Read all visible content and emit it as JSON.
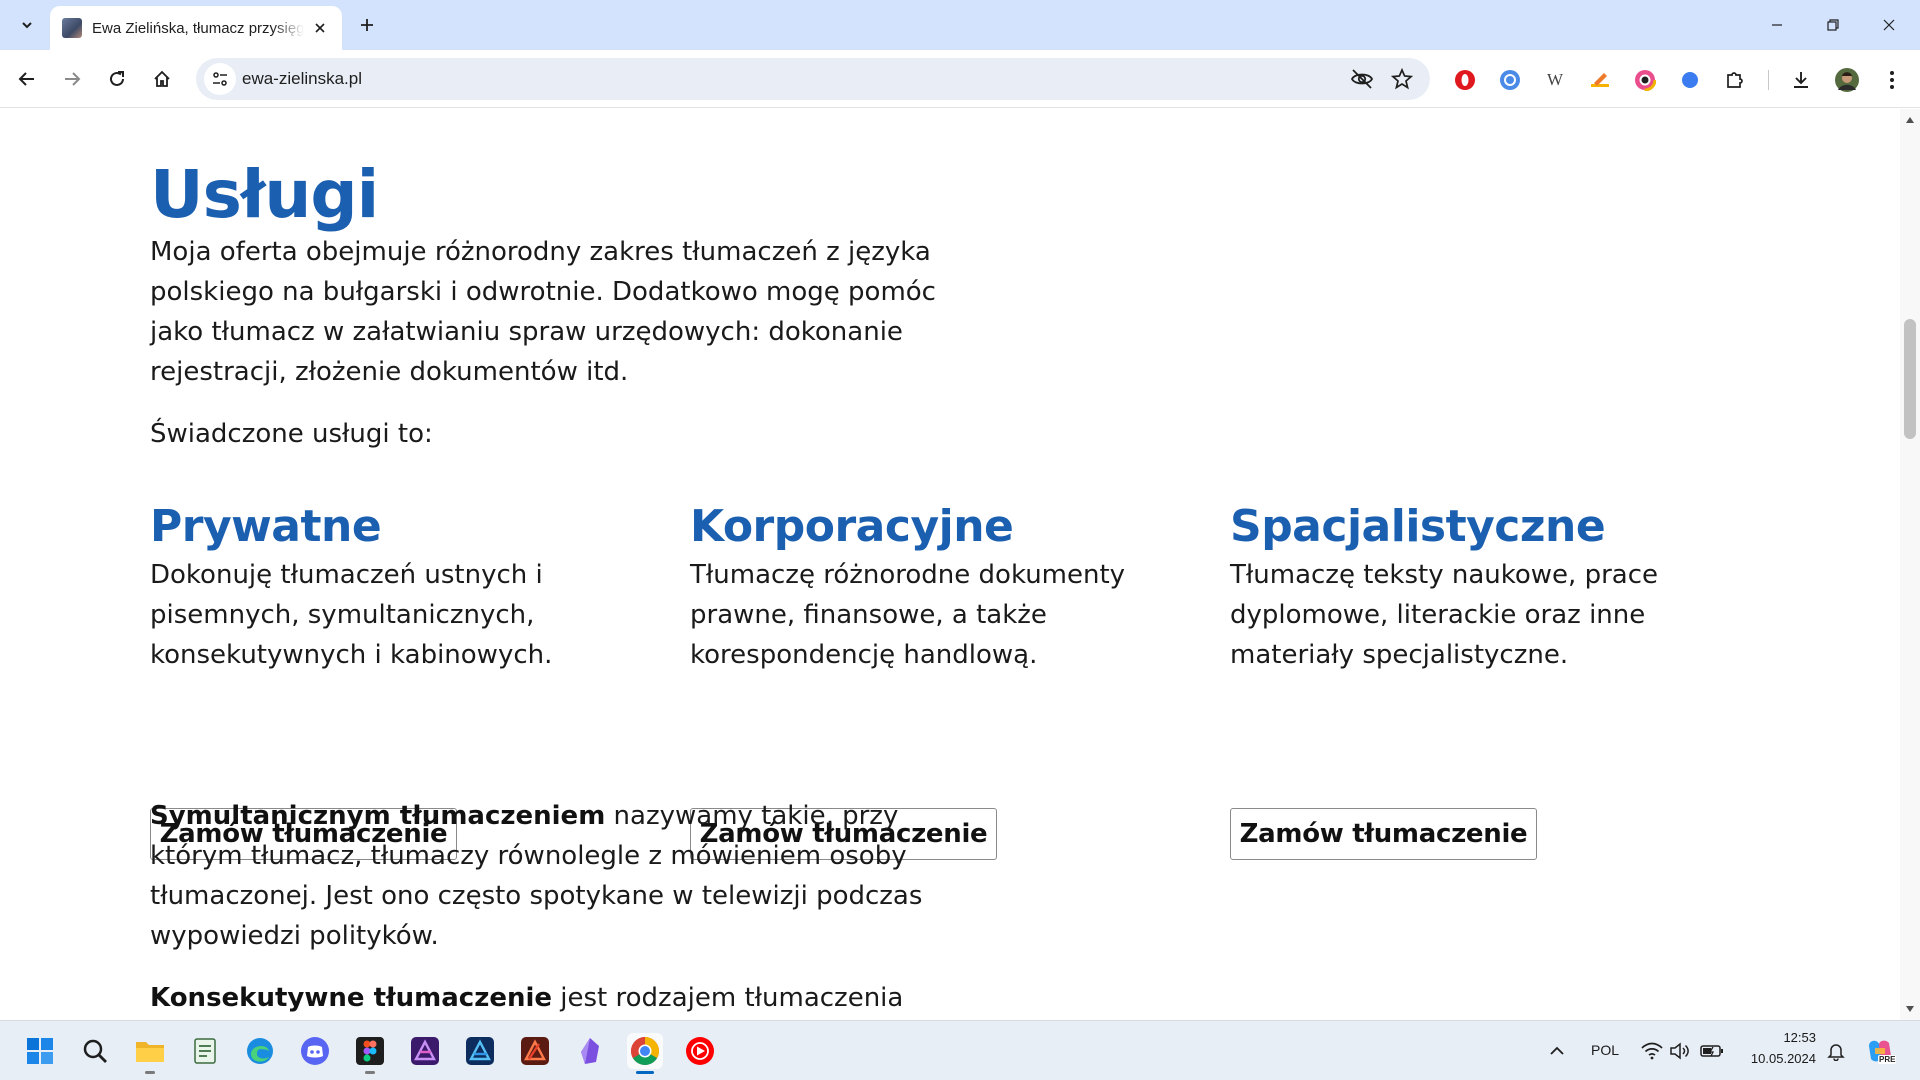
{
  "browser": {
    "tab_title": "Ewa Zielińska, tłumacz przysięgły",
    "url": "ewa-zielinska.pl",
    "tab_list_icon": "chevron-down-icon",
    "new_tab_icon": "plus-icon",
    "window_controls": [
      "minimize-icon",
      "restore-icon",
      "close-icon"
    ],
    "nav_icons": [
      "back-arrow-icon",
      "forward-arrow-icon",
      "reload-icon",
      "home-icon"
    ],
    "omnibox_icons": [
      "site-settings-icon",
      "eye-off-icon",
      "star-icon"
    ],
    "extensions": [
      "opera-extension-icon",
      "blue-circle-extension-icon",
      "w-extension-icon",
      "pencil-extension-icon",
      "color-picker-extension-icon",
      "blue-dot-extension-icon",
      "puzzle-extensions-icon"
    ],
    "extension_w_letter": "W",
    "right_icons": [
      "download-icon",
      "profile-avatar",
      "more-menu-icon"
    ],
    "accent": "#d3e3fd"
  },
  "page": {
    "heading": "Usługi",
    "intro": "Moja oferta obejmuje różnorodny zakres tłumaczeń z języka polskiego na bułgarski i odwrotnie. Dodatkowo mogę pomóc jako tłumacz w załatwianiu spraw urzędowych: dokonanie rejestracji, złożenie dokumentów itd.",
    "lead": "Świadczone usługi to:",
    "services": [
      {
        "title": "Prywatne",
        "description": "Dokonuję tłumaczeń ustnych i pisemnych, symultanicznych, konsekutywnych i kabinowych.",
        "button": "Zamów tłumaczenie"
      },
      {
        "title": "Korporacyjne",
        "description": "Tłumaczę różnorodne dokumenty prawne, finansowe, a także korespondencję handlową.",
        "button": "Zamów tłumaczenie"
      },
      {
        "title": "Spacjalistyczne",
        "description": "Tłumaczę teksty naukowe, prace dyplomowe, literackie oraz inne materiały specjalistyczne.",
        "button": "Zamów tłumaczenie"
      }
    ],
    "para1_bold": "Symultanicznym tłumaczeniem",
    "para1_rest": " nazywamy takie, przy którym tłumacz, tłumaczy równolegle z mówieniem osoby tłumaczonej. Jest ono często spotykane w telewizji podczas wypowiedzi polityków.",
    "para2_bold": "Konsekutywne tłumaczenie",
    "para2_rest": " jest rodzajem tłumaczenia",
    "heading_color": "#1b5fb0"
  },
  "taskbar": {
    "apps": [
      "windows-start-icon",
      "search-icon",
      "file-explorer-icon",
      "notepad-icon",
      "edge-icon",
      "discord-icon",
      "figma-icon",
      "affinity-photo-icon",
      "affinity-designer-icon",
      "affinity-publisher-icon",
      "obsidian-icon",
      "chrome-icon",
      "youtube-music-icon"
    ],
    "tray": {
      "chevron_icon": "chevron-up-icon",
      "language": "POL",
      "icons": [
        "wifi-icon",
        "volume-icon",
        "battery-icon"
      ],
      "time": "12:53",
      "date": "10.05.2024",
      "notification_icon": "notification-icon",
      "copilot_icon": "copilot-icon",
      "copilot_badge": "PRE"
    }
  }
}
